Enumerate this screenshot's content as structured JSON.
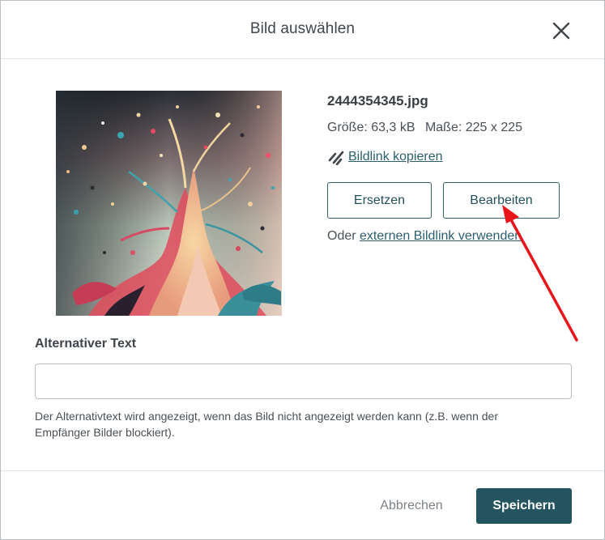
{
  "dialog": {
    "title": "Bild auswählen"
  },
  "image": {
    "filename": "2444354345.jpg",
    "size": "Größe: 63,3 kB",
    "dimensions": "Maße: 225 x 225",
    "copy_link_label": "Bildlink kopieren",
    "copy_link_icon": "link-icon"
  },
  "actions": {
    "replace_label": "Ersetzen",
    "edit_label": "Bearbeiten",
    "external_prefix": "Oder",
    "external_link": "externen Bildlink verwenden"
  },
  "alt_text": {
    "label": "Alternativer Text",
    "value": "",
    "placeholder": "",
    "help": "Der Alternativtext wird angezeigt, wenn das Bild nicht angezeigt werden kann (z.B. wenn der Empfänger Bilder blockiert)."
  },
  "footer": {
    "cancel_label": "Abbrechen",
    "save_label": "Speichern"
  },
  "colors": {
    "primary": "#23545f",
    "link": "#2b5f6e",
    "annotation_arrow": "#e8151b"
  }
}
